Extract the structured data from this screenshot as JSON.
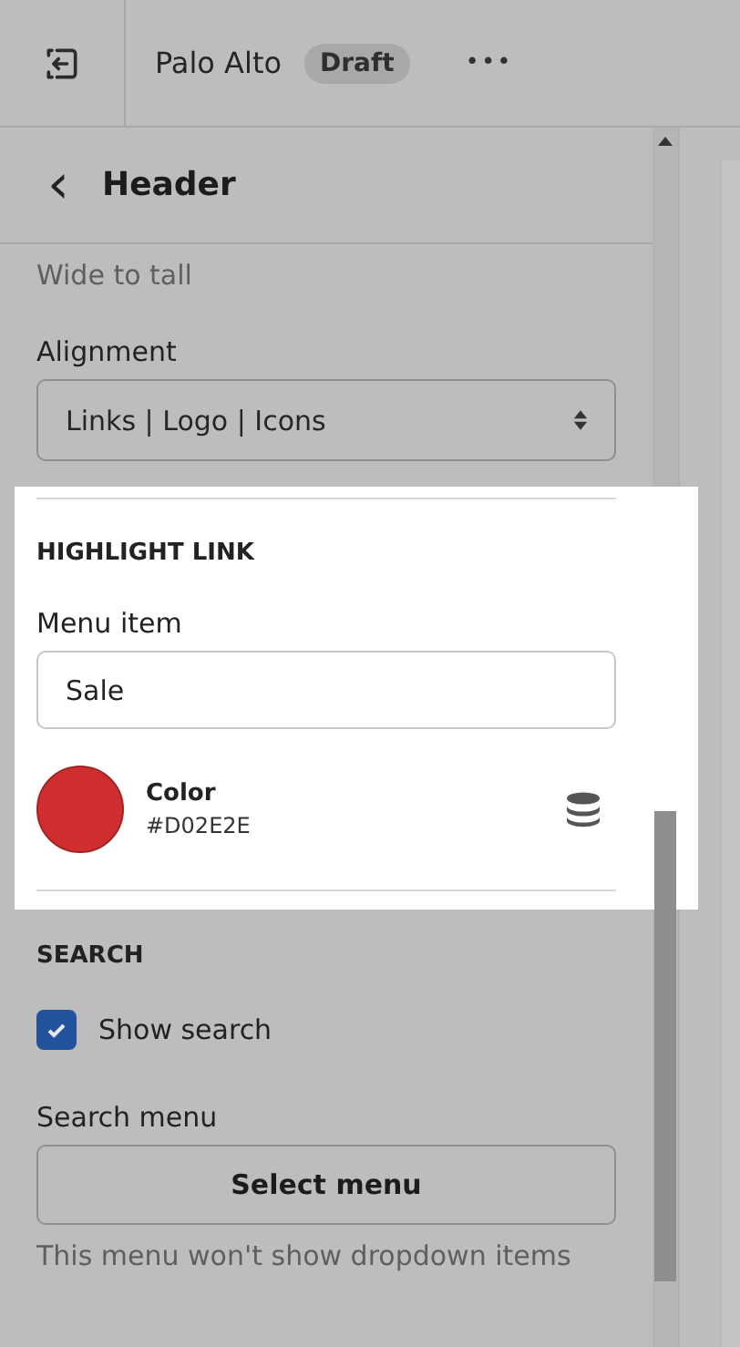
{
  "topbar": {
    "store_name": "Palo Alto",
    "status_badge": "Draft",
    "more": "•••"
  },
  "panel": {
    "title": "Header",
    "back": "‹"
  },
  "fields": [
    {
      "kind": "text",
      "text": "Wide to tall"
    },
    {
      "kind": "select",
      "label": "Alignment",
      "value": "Links | Logo | Icons"
    }
  ],
  "highlight_section": {
    "heading": "HIGHLIGHT LINK",
    "menu_item": {
      "label": "Menu item",
      "value": "Sale"
    },
    "color": {
      "label": "Color",
      "value": "#D02E2E",
      "color": "#d02e2e"
    }
  },
  "search_section": {
    "heading": "SEARCH",
    "show_search": {
      "label": "Show search",
      "checked": true
    },
    "search_menu": {
      "label": "Search menu",
      "button": "Select menu",
      "help": "This menu won't show dropdown items"
    }
  }
}
